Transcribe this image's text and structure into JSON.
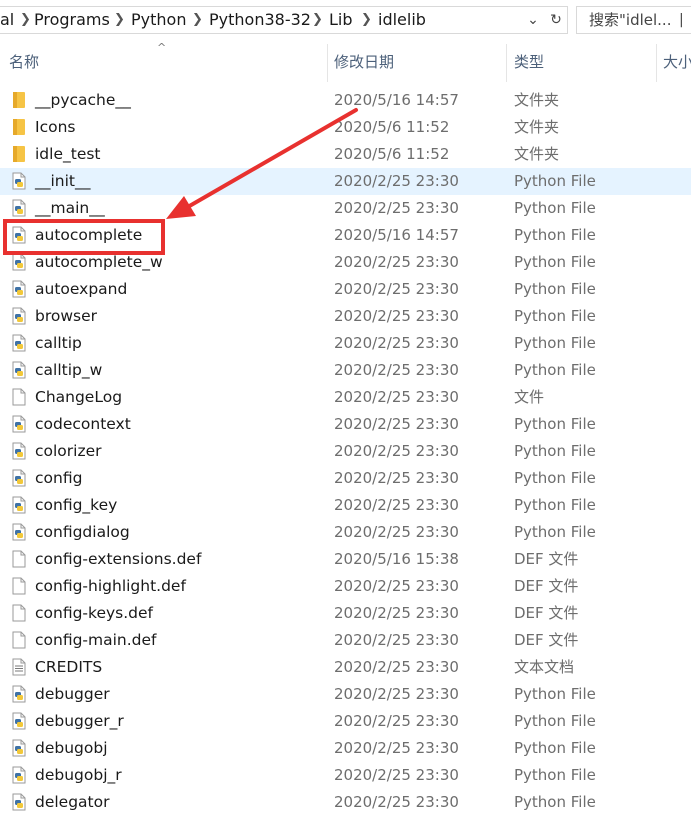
{
  "address_bar": {
    "crumbs": [
      "al",
      "Programs",
      "Python",
      "Python38-32",
      "Lib",
      "idlelib"
    ],
    "dropdown_icon": "chevron-down-icon",
    "refresh_icon": "refresh-icon"
  },
  "search": {
    "text": "搜索\"idlel...",
    "more": "|"
  },
  "columns": {
    "name": "名称",
    "date": "修改日期",
    "type": "类型",
    "size": "大小"
  },
  "files": [
    {
      "name": "__pycache__",
      "date": "2020/5/16 14:57",
      "type": "文件夹",
      "icon": "folder"
    },
    {
      "name": "Icons",
      "date": "2020/5/6 11:52",
      "type": "文件夹",
      "icon": "folder"
    },
    {
      "name": "idle_test",
      "date": "2020/5/6 11:52",
      "type": "文件夹",
      "icon": "folder"
    },
    {
      "name": "__init__",
      "date": "2020/2/25 23:30",
      "type": "Python File",
      "icon": "python"
    },
    {
      "name": "__main__",
      "date": "2020/2/25 23:30",
      "type": "Python File",
      "icon": "python"
    },
    {
      "name": "autocomplete",
      "date": "2020/5/16 14:57",
      "type": "Python File",
      "icon": "python"
    },
    {
      "name": "autocomplete_w",
      "date": "2020/2/25 23:30",
      "type": "Python File",
      "icon": "python"
    },
    {
      "name": "autoexpand",
      "date": "2020/2/25 23:30",
      "type": "Python File",
      "icon": "python"
    },
    {
      "name": "browser",
      "date": "2020/2/25 23:30",
      "type": "Python File",
      "icon": "python"
    },
    {
      "name": "calltip",
      "date": "2020/2/25 23:30",
      "type": "Python File",
      "icon": "python"
    },
    {
      "name": "calltip_w",
      "date": "2020/2/25 23:30",
      "type": "Python File",
      "icon": "python"
    },
    {
      "name": "ChangeLog",
      "date": "2020/2/25 23:30",
      "type": "文件",
      "icon": "file"
    },
    {
      "name": "codecontext",
      "date": "2020/2/25 23:30",
      "type": "Python File",
      "icon": "python"
    },
    {
      "name": "colorizer",
      "date": "2020/2/25 23:30",
      "type": "Python File",
      "icon": "python"
    },
    {
      "name": "config",
      "date": "2020/2/25 23:30",
      "type": "Python File",
      "icon": "python"
    },
    {
      "name": "config_key",
      "date": "2020/2/25 23:30",
      "type": "Python File",
      "icon": "python"
    },
    {
      "name": "configdialog",
      "date": "2020/2/25 23:30",
      "type": "Python File",
      "icon": "python"
    },
    {
      "name": "config-extensions.def",
      "date": "2020/5/16 15:38",
      "type": "DEF 文件",
      "icon": "file"
    },
    {
      "name": "config-highlight.def",
      "date": "2020/2/25 23:30",
      "type": "DEF 文件",
      "icon": "file"
    },
    {
      "name": "config-keys.def",
      "date": "2020/2/25 23:30",
      "type": "DEF 文件",
      "icon": "file"
    },
    {
      "name": "config-main.def",
      "date": "2020/2/25 23:30",
      "type": "DEF 文件",
      "icon": "file"
    },
    {
      "name": "CREDITS",
      "date": "2020/2/25 23:30",
      "type": "文本文档",
      "icon": "text"
    },
    {
      "name": "debugger",
      "date": "2020/2/25 23:30",
      "type": "Python File",
      "icon": "python"
    },
    {
      "name": "debugger_r",
      "date": "2020/2/25 23:30",
      "type": "Python File",
      "icon": "python"
    },
    {
      "name": "debugobj",
      "date": "2020/2/25 23:30",
      "type": "Python File",
      "icon": "python"
    },
    {
      "name": "debugobj_r",
      "date": "2020/2/25 23:30",
      "type": "Python File",
      "icon": "python"
    },
    {
      "name": "delegator",
      "date": "2020/2/25 23:30",
      "type": "Python File",
      "icon": "python"
    }
  ],
  "hovered_row": "__init__",
  "annotation": {
    "highlighted_file": "autocomplete",
    "color": "#e8312f"
  }
}
